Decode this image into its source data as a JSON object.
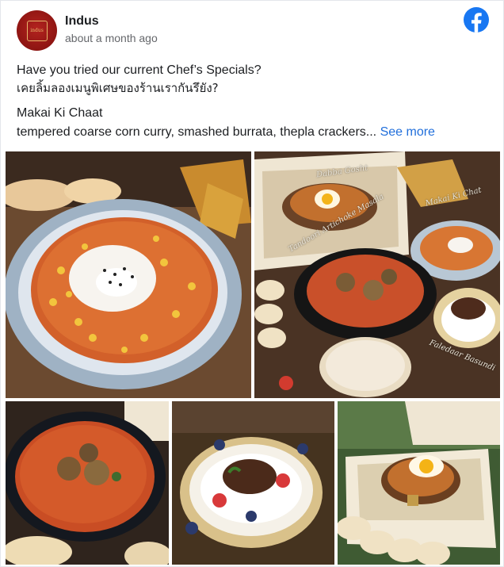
{
  "post": {
    "page_name": "Indus",
    "avatar_text": "indus",
    "timestamp": "about a month ago",
    "lines": [
      "Have you tried our current Chef’s Specials?",
      "เคยลิ้มลองเมนูพิเศษของร้านเรากันรึยัง?",
      "Makai Ki Chaat",
      "tempered coarse corn curry, smashed burrata, thepla crackers..."
    ],
    "see_more": "See more"
  },
  "platform_icon": "facebook-icon",
  "photos": {
    "labels": {
      "dabba_gosht": "Dabba Gosht",
      "makai_ki_chat": "Makai Ki Chat",
      "tandoori": "Tandoori Artichoke Masala",
      "faledaar": "Faledaar Basundi"
    }
  },
  "colors": {
    "brand_red": "#8e1512",
    "facebook_blue": "#1877f2",
    "link_blue": "#216fdb",
    "meta_grey": "#65676b"
  }
}
